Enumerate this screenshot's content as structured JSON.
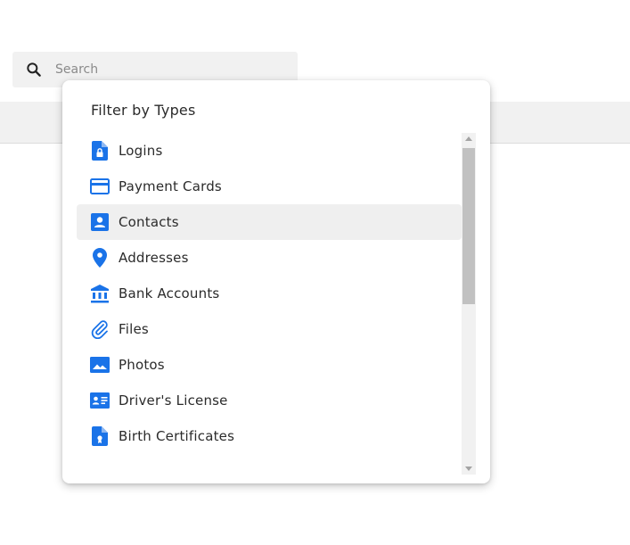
{
  "search": {
    "placeholder": "Search",
    "icon": "search-icon"
  },
  "filter_menu": {
    "title": "Filter by Types",
    "highlighted_item": "Contacts",
    "accent_color": "#1a73e8",
    "items": [
      {
        "label": "Logins",
        "icon": "login-document-lock-icon"
      },
      {
        "label": "Payment Cards",
        "icon": "payment-card-icon"
      },
      {
        "label": "Contacts",
        "icon": "contact-card-icon"
      },
      {
        "label": "Addresses",
        "icon": "location-pin-icon"
      },
      {
        "label": "Bank Accounts",
        "icon": "bank-icon"
      },
      {
        "label": "Files",
        "icon": "paperclip-icon"
      },
      {
        "label": "Photos",
        "icon": "photo-icon"
      },
      {
        "label": "Driver's License",
        "icon": "id-card-icon"
      },
      {
        "label": "Birth Certificates",
        "icon": "certificate-document-icon"
      }
    ]
  }
}
